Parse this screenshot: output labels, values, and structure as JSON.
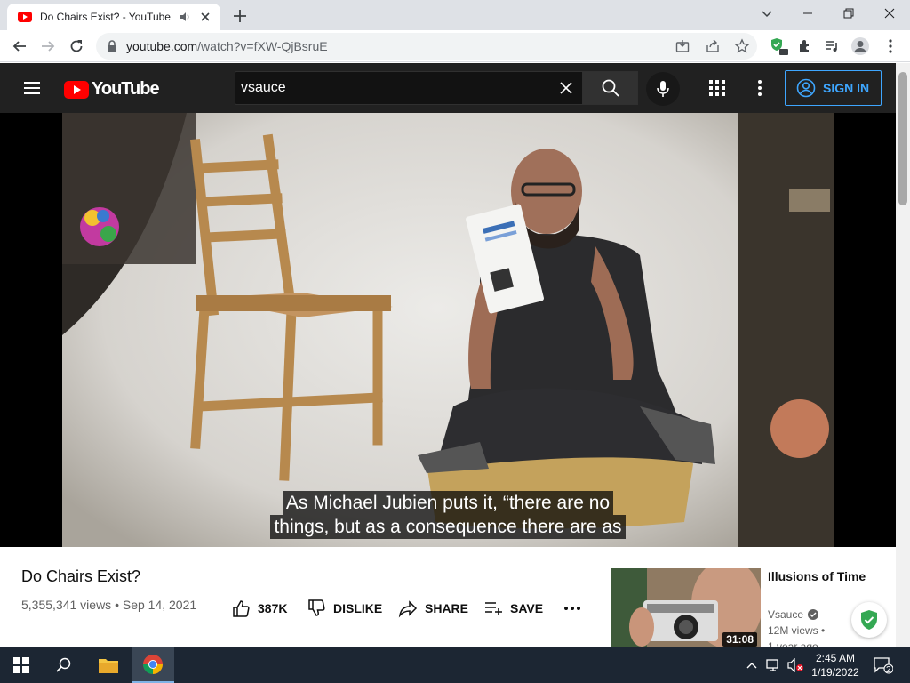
{
  "browser": {
    "tab_title": "Do Chairs Exist? - YouTube",
    "url_host": "youtube.com",
    "url_path": "/watch?v=fXW-QjBsruE"
  },
  "masthead": {
    "logo_text": "YouTube",
    "search_value": "vsauce",
    "search_placeholder": "Search",
    "sign_in_label": "SIGN IN"
  },
  "player": {
    "caption_line_1": "As Michael Jubien puts it, “there are no",
    "caption_line_2": "things, but as a consequence there are as"
  },
  "video": {
    "title": "Do Chairs Exist?",
    "meta": "5,355,341 views • Sep 14, 2021",
    "like_count": "387K",
    "dislike_label": "DISLIKE",
    "share_label": "SHARE",
    "save_label": "SAVE"
  },
  "recommendation": {
    "title": "Illusions of Time",
    "channel": "Vsauce",
    "views": "12M views •",
    "age": "1 year ago",
    "duration": "31:08"
  },
  "taskbar": {
    "time": "2:45 AM",
    "date": "1/19/2022",
    "notification_count": "2"
  },
  "colors": {
    "yt_red": "#ff0000",
    "masthead_bg": "#212121",
    "signin_blue": "#3ea6ff",
    "taskbar_bg": "#1c2633"
  }
}
